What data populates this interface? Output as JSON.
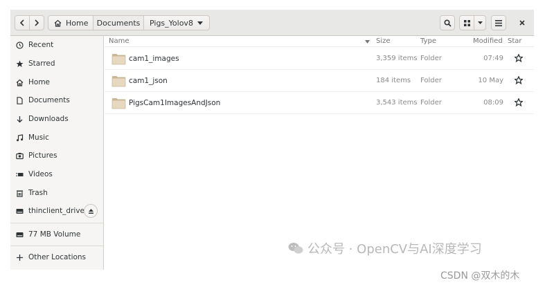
{
  "header": {
    "breadcrumbs": [
      "Home",
      "Documents",
      "Pigs_Yolov8"
    ]
  },
  "sidebar": {
    "items": [
      {
        "label": "Recent",
        "icon": "clock-icon"
      },
      {
        "label": "Starred",
        "icon": "star-icon"
      },
      {
        "label": "Home",
        "icon": "home-icon"
      },
      {
        "label": "Documents",
        "icon": "document-icon"
      },
      {
        "label": "Downloads",
        "icon": "download-icon"
      },
      {
        "label": "Music",
        "icon": "music-icon"
      },
      {
        "label": "Pictures",
        "icon": "camera-icon"
      },
      {
        "label": "Videos",
        "icon": "video-icon"
      },
      {
        "label": "Trash",
        "icon": "trash-icon"
      },
      {
        "label": "thinclient_drives",
        "icon": "drive-icon"
      },
      {
        "label": "77 MB Volume",
        "icon": "drive-icon"
      },
      {
        "label": "Other Locations",
        "icon": "plus-icon"
      }
    ]
  },
  "list": {
    "columns": {
      "name": "Name",
      "size": "Size",
      "type": "Type",
      "modified": "Modified",
      "star": "Star"
    },
    "rows": [
      {
        "name": "cam1_images",
        "size": "3,359 items",
        "type": "Folder",
        "modified": "07:49"
      },
      {
        "name": "cam1_json",
        "size": "184 items",
        "type": "Folder",
        "modified": "10 May"
      },
      {
        "name": "PigsCam1ImagesAndJson",
        "size": "3,543 items",
        "type": "Folder",
        "modified": "08:09"
      }
    ]
  },
  "watermark": {
    "text": "公众号 · OpenCV与AI深度学习",
    "credit": "CSDN @双木的木"
  },
  "colors": {
    "folder": "#d8c3a5",
    "header_bg": "#e8e8e7",
    "sidebar_bg": "#f6f5f4"
  }
}
